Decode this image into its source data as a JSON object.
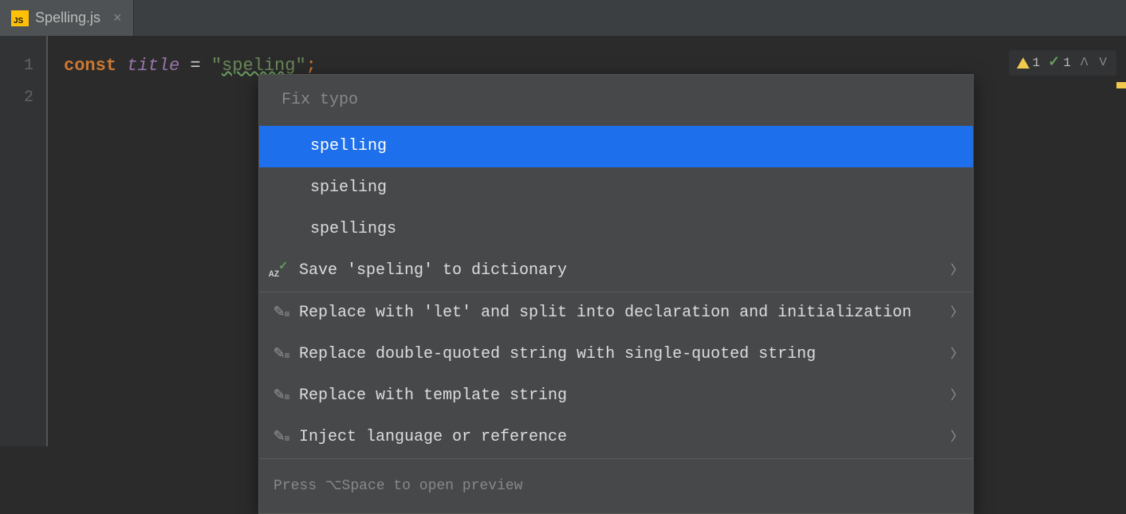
{
  "tab": {
    "filename": "Spelling.js"
  },
  "gutter": {
    "lines": [
      "1",
      "2"
    ]
  },
  "code": {
    "keyword": "const",
    "variable": "title",
    "equals": " = ",
    "quote1": "\"",
    "string_content": "speling",
    "quote2": "\"",
    "semicolon": ";"
  },
  "inspections": {
    "warning_count": "1",
    "typo_count": "1"
  },
  "popup": {
    "header": "Fix typo",
    "suggestions": [
      "spelling",
      "spieling",
      "spellings"
    ],
    "save_dict": "Save 'speling' to dictionary",
    "actions": [
      "Replace with 'let' and split into declaration and initialization",
      "Replace double-quoted string with single-quoted string",
      "Replace with template string",
      "Inject language or reference"
    ],
    "footer": "Press ⌥Space to open preview"
  }
}
